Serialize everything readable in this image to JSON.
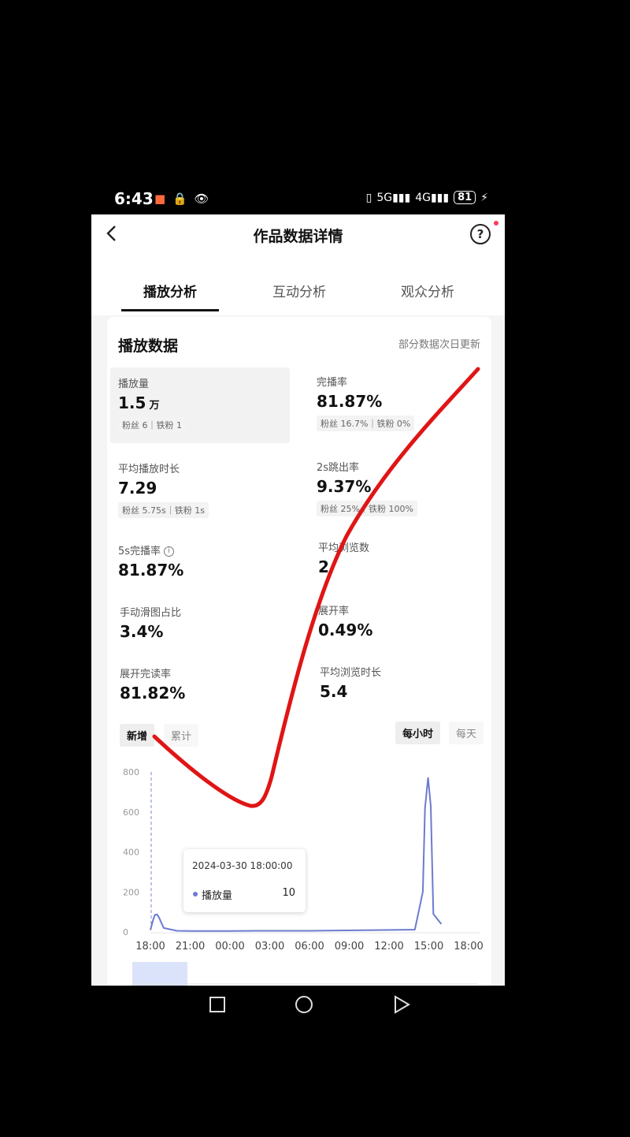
{
  "status_bar": {
    "time": "6:43",
    "left_icons": [
      "app-badge-icon",
      "lock-icon",
      "eye-icon"
    ],
    "right_icons": [
      "vibrate-icon",
      "signal-5g-icon",
      "signal-4g-icon"
    ],
    "battery": "81"
  },
  "nav": {
    "title": "作品数据详情"
  },
  "tabs": [
    {
      "label": "播放分析",
      "active": true
    },
    {
      "label": "互动分析",
      "active": false
    },
    {
      "label": "观众分析",
      "active": false
    }
  ],
  "card": {
    "title": "播放数据",
    "note": "部分数据次日更新",
    "metrics": {
      "plays": {
        "label": "播放量",
        "value": "1.5",
        "unit": "万",
        "sub": "粉丝 6｜铁粉 1"
      },
      "completion": {
        "label": "完播率",
        "value": "81.87%",
        "sub": "粉丝 16.7%｜铁粉 0%"
      },
      "avg_duration": {
        "label": "平均播放时长",
        "value": "7.29",
        "sub": "粉丝 5.75s｜铁粉 1s"
      },
      "bounce_2s": {
        "label": "2s跳出率",
        "value": "9.37%",
        "sub": "粉丝 25%｜铁粉 100%"
      },
      "completion_5s": {
        "label": "5s完播率",
        "value": "81.87%"
      },
      "avg_views": {
        "label": "平均浏览数",
        "value": "2"
      },
      "swipe_ratio": {
        "label": "手动滑图占比",
        "value": "3.4%"
      },
      "expand_rate": {
        "label": "展开率",
        "value": "0.49%"
      },
      "expand_read": {
        "label": "展开完读率",
        "value": "81.82%"
      },
      "avg_browse_time": {
        "label": "平均浏览时长",
        "value": "5.4"
      }
    },
    "toggle_left": [
      "新增",
      "累计"
    ],
    "toggle_right": [
      "每小时",
      "每天"
    ]
  },
  "chart_data": {
    "type": "line",
    "y_ticks": [
      "800",
      "600",
      "400",
      "200",
      "0"
    ],
    "ylim": [
      0,
      800
    ],
    "x_ticks": [
      "18:00",
      "21:00",
      "00:00",
      "03:00",
      "06:00",
      "09:00",
      "12:00",
      "15:00",
      "18:00"
    ],
    "series": [
      {
        "name": "播放量",
        "color": "#6c7bd0",
        "x": [
          0,
          0.6,
          1.0,
          1.5,
          2,
          3,
          6,
          9,
          12,
          18,
          24,
          36,
          60,
          61.8,
          62.3,
          63,
          63.6,
          64.2,
          66
        ],
        "y": [
          10,
          60,
          85,
          88,
          70,
          20,
          6,
          5,
          5,
          5,
          6,
          6,
          12,
          200,
          620,
          770,
          630,
          90,
          40
        ]
      }
    ],
    "tooltip": {
      "time": "2024-03-30 18:00:00",
      "series": "播放量",
      "value": "10"
    }
  }
}
